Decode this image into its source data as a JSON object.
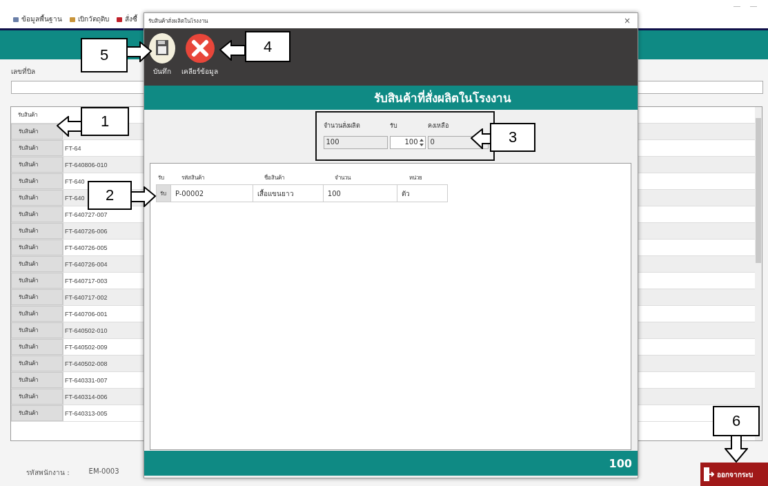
{
  "menu": [
    {
      "label": "ข้อมูลพื้นฐาน",
      "kind": "data"
    },
    {
      "label": "เบิกวัตถุดิบ",
      "kind": "box"
    },
    {
      "label": "สั่งซื้",
      "kind": "cart"
    }
  ],
  "bill": {
    "label": "เลขที่บิล"
  },
  "list": {
    "columns": [
      "รับสินค้า"
    ],
    "rows": [
      {
        "action": "รับสินค้า"
      },
      {
        "action": "รับสินค้า",
        "code": "FT-64"
      },
      {
        "action": "รับสินค้า",
        "code": "FT-640806-010"
      },
      {
        "action": "รับสินค้า",
        "code": "FT-640"
      },
      {
        "action": "รับสินค้า",
        "code": "FT-640"
      },
      {
        "action": "รับสินค้า",
        "code": "FT-640727-007"
      },
      {
        "action": "รับสินค้า",
        "code": "FT-640726-006"
      },
      {
        "action": "รับสินค้า",
        "code": "FT-640726-005"
      },
      {
        "action": "รับสินค้า",
        "code": "FT-640726-004"
      },
      {
        "action": "รับสินค้า",
        "code": "FT-640717-003"
      },
      {
        "action": "รับสินค้า",
        "code": "FT-640717-002"
      },
      {
        "action": "รับสินค้า",
        "code": "FT-640706-001"
      },
      {
        "action": "รับสินค้า",
        "code": "FT-640502-010"
      },
      {
        "action": "รับสินค้า",
        "code": "FT-640502-009"
      },
      {
        "action": "รับสินค้า",
        "code": "FT-640502-008"
      },
      {
        "action": "รับสินค้า",
        "code": "FT-640331-007"
      },
      {
        "action": "รับสินค้า",
        "code": "FT-640314-006"
      },
      {
        "action": "รับสินค้า",
        "code": "FT-640313-005"
      }
    ]
  },
  "status_bar": {
    "label": "รหัสพนักงาน :",
    "value": "EM-0003"
  },
  "exit_button": {
    "label": "ออกจากระบ"
  },
  "dialog": {
    "title": "รับสินค้าสั่งผลิตในโรงงาน",
    "close": "×",
    "toolbar": [
      {
        "label": "บันทึก",
        "kind": "save"
      },
      {
        "label": "เคลียร์ข้อมูล",
        "kind": "clear"
      }
    ],
    "heading": "รับสินค้าที่สั่งผลิตในโรงงาน",
    "fields": [
      {
        "label": "จำนวนสั่งผลิต",
        "value": "100",
        "kind": "readonly"
      },
      {
        "label": "รับ",
        "value": "100",
        "kind": "spinner"
      },
      {
        "label": "คงเหลือ",
        "value": "0",
        "kind": "readonly"
      }
    ],
    "table": {
      "columns": [
        "รับ",
        "รหัสสินค้า",
        "ชื่อสินค้า",
        "จำนวน",
        "หน่วย"
      ],
      "rows": [
        {
          "cells": [
            "รับ",
            "P-00002",
            "เสื้อแขนยาว",
            "100",
            "ตัว"
          ]
        }
      ]
    },
    "total": "100"
  },
  "annotations": [
    {
      "number": "1",
      "kind": "left"
    },
    {
      "number": "2",
      "kind": "right"
    },
    {
      "number": "3",
      "kind": "left"
    },
    {
      "number": "4",
      "kind": "left"
    },
    {
      "number": "5",
      "kind": "right"
    },
    {
      "number": "6",
      "kind": "down"
    }
  ]
}
